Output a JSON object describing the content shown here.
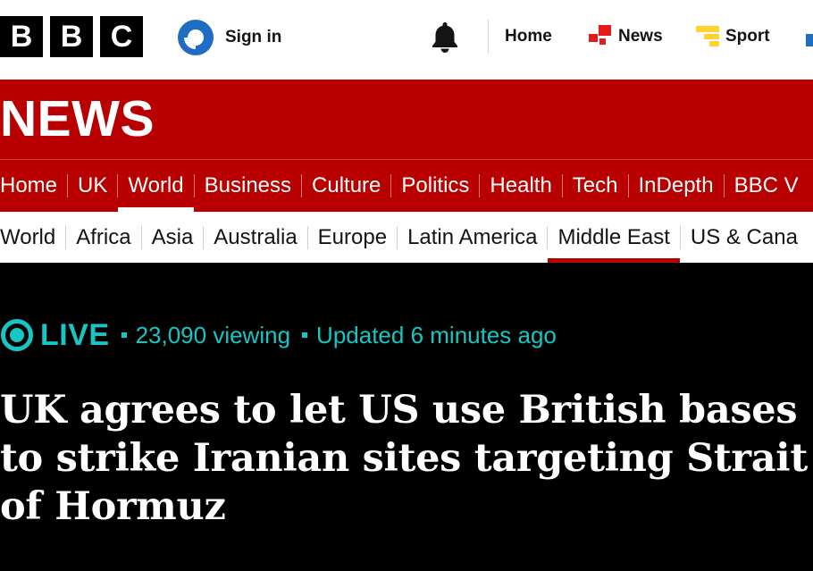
{
  "brand": {
    "letters": [
      "B",
      "B",
      "C"
    ]
  },
  "header": {
    "sign_in_label": "Sign in",
    "nav": [
      {
        "label": "Home",
        "icon": ""
      },
      {
        "label": "News",
        "icon": "news-icon"
      },
      {
        "label": "Sport",
        "icon": "sport-icon"
      }
    ]
  },
  "banner": {
    "wordmark": "NEWS"
  },
  "section_nav": {
    "items": [
      "Home",
      "UK",
      "World",
      "Business",
      "Culture",
      "Politics",
      "Health",
      "Tech",
      "InDepth",
      "BBC V"
    ],
    "active": "World"
  },
  "sub_nav": {
    "items": [
      "World",
      "Africa",
      "Asia",
      "Australia",
      "Europe",
      "Latin America",
      "Middle East",
      "US & Cana"
    ],
    "active": "Middle East"
  },
  "live": {
    "label": "LIVE",
    "viewing": "23,090 viewing",
    "updated": "Updated 6 minutes ago"
  },
  "article": {
    "headline": "UK agrees to let US use British bases to strike Iranian sites targeting Strait of Hormuz"
  },
  "colors": {
    "brand_red": "#b80000",
    "live_teal": "#17c6c2",
    "sign_in_blue": "#1f6cc3",
    "sport_yellow": "#ffd230"
  }
}
